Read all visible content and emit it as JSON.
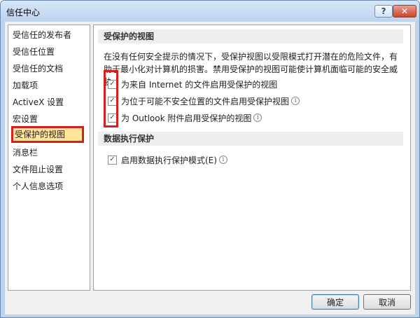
{
  "window": {
    "title": "信任中心",
    "help_glyph": "?",
    "close_glyph": "✕"
  },
  "sidebar": {
    "items": [
      {
        "label": "受信任的发布者"
      },
      {
        "label": "受信任位置"
      },
      {
        "label": "受信任的文档"
      },
      {
        "label": "加载项"
      },
      {
        "label": "ActiveX 设置"
      },
      {
        "label": "宏设置"
      },
      {
        "label": "受保护的视图",
        "selected": true
      },
      {
        "label": "消息栏"
      },
      {
        "label": "文件阻止设置"
      },
      {
        "label": "个人信息选项"
      }
    ]
  },
  "main": {
    "protected_view": {
      "header": "受保护的视图",
      "description": "在没有任何安全提示的情况下，受保护视图以受限模式打开潜在的危险文件，有助于最小化对计算机的损害。禁用受保护的视图可能使计算机面临可能的安全威胁。",
      "options": [
        {
          "label": "为来自 Internet 的文件启用受保护的视图",
          "checked": true,
          "info": false
        },
        {
          "label": "为位于可能不安全位置的文件启用受保护视图",
          "checked": true,
          "info": true
        },
        {
          "label": "为 Outlook 附件启用受保护的视图",
          "checked": true,
          "info": true
        }
      ]
    },
    "dep": {
      "header": "数据执行保护",
      "options": [
        {
          "label": "启用数据执行保护模式(E)",
          "checked": true,
          "info": true
        }
      ]
    },
    "check_glyph": "✓",
    "info_glyph": "i"
  },
  "buttons": {
    "ok": "确定",
    "cancel": "取消"
  },
  "colors": {
    "highlight_box": "#d42020",
    "selected_bg": "#ffe49a"
  }
}
